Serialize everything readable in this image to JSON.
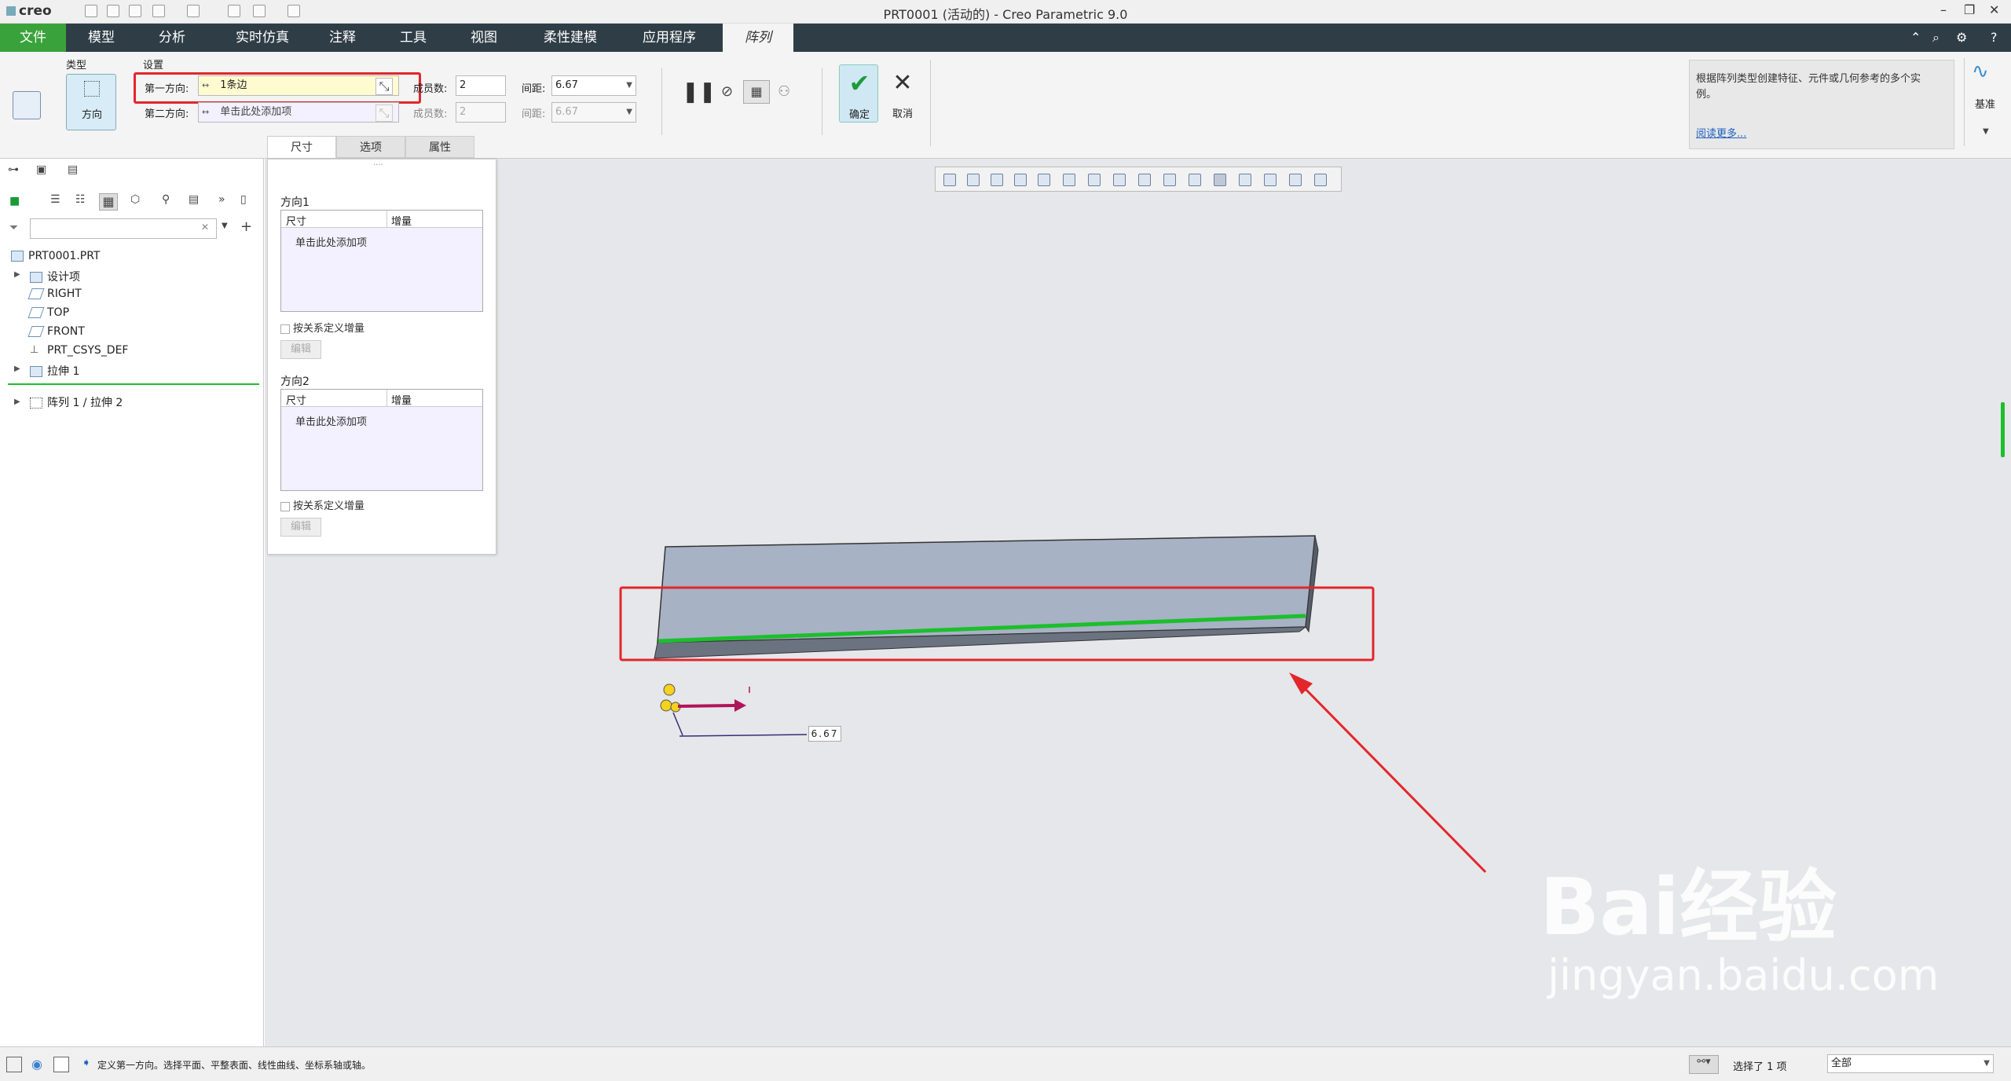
{
  "titlebar": {
    "app_logo": "creo",
    "window_title": "PRT0001 (活动的) - Creo Parametric 9.0"
  },
  "menu": {
    "tabs": [
      "文件",
      "模型",
      "分析",
      "实时仿真",
      "注释",
      "工具",
      "视图",
      "柔性建模",
      "应用程序",
      "阵列"
    ],
    "active_tab": "阵列"
  },
  "ribbon": {
    "type_group_label": "类型",
    "type_button_label": "方向",
    "settings_group_label": "设置",
    "dir1_label": "第一方向:",
    "dir1_value": "1条边",
    "dir2_label": "第二方向:",
    "dir2_placeholder": "单击此处添加项",
    "members_label": "成员数:",
    "members1_value": "2",
    "members2_value": "2",
    "spacing_label": "间距:",
    "spacing1_value": "6.67",
    "spacing2_value": "6.67",
    "ok_label": "确定",
    "cancel_label": "取消",
    "datum_label": "基准"
  },
  "dashboard_tabs": [
    "尺寸",
    "选项",
    "属性"
  ],
  "dim_panel": {
    "dir1_title": "方向1",
    "dir2_title": "方向2",
    "col_dim": "尺寸",
    "col_incr": "增量",
    "add_placeholder": "单击此处添加项",
    "relation_checkbox": "按关系定义增量",
    "edit_button": "编辑"
  },
  "model_tree": {
    "items": [
      "PRT0001.PRT",
      "设计项",
      "RIGHT",
      "TOP",
      "FRONT",
      "PRT_CSYS_DEF",
      "拉伸 1",
      "阵列 1 / 拉伸 2"
    ]
  },
  "graphics": {
    "dimension_label": "6.67"
  },
  "info_panel": {
    "text": "根据阵列类型创建特征、元件或几何参考的多个实例。",
    "link": "阅读更多..."
  },
  "statusbar": {
    "message": "定义第一方向。选择平面、平整表面、线性曲线、坐标系轴或轴。",
    "selection": "选择了 1 项",
    "filter": "全部"
  },
  "watermark": {
    "brand": "Bai经验",
    "url": "jingyan.baidu.com"
  },
  "colors": {
    "accent_green": "#3aa23a",
    "menu_bg": "#2f3d46",
    "highlight_red": "#e3262c"
  }
}
